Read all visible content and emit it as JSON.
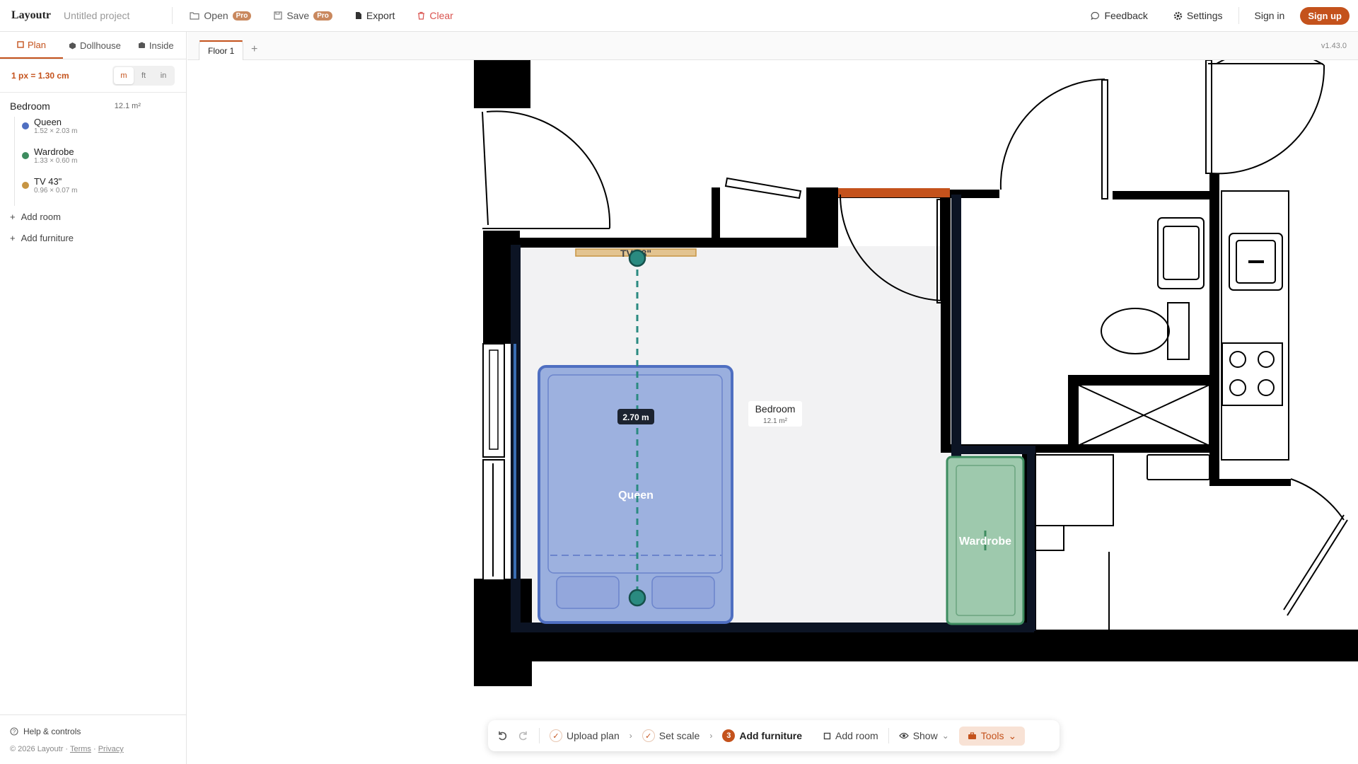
{
  "topbar": {
    "brand": "Layoutr",
    "project": "Untitled project",
    "open": "Open",
    "save": "Save",
    "pro_badge": "Pro",
    "export": "Export",
    "clear": "Clear",
    "feedback": "Feedback",
    "settings": "Settings",
    "sign_in": "Sign in",
    "sign_up": "Sign up"
  },
  "sidebar": {
    "tabs": [
      {
        "label": "Plan"
      },
      {
        "label": "Dollhouse"
      },
      {
        "label": "Inside"
      }
    ],
    "scale_label": "1 px = 1.30 cm",
    "units": [
      "m",
      "ft",
      "in"
    ],
    "room": {
      "name": "Bedroom",
      "area": "12.1 m²"
    },
    "items": [
      {
        "name": "Queen",
        "dims": "1.52 × 2.03 m",
        "color": "#4f6fc1"
      },
      {
        "name": "Wardrobe",
        "dims": "1.33 × 0.60 m",
        "color": "#3d8c5f"
      },
      {
        "name": "TV 43\"",
        "dims": "0.96 × 0.07 m",
        "color": "#c79542"
      }
    ],
    "add_room": "Add room",
    "add_furniture": "Add furniture",
    "help": "Help & controls",
    "copyright": "© 2026 Layoutr ·",
    "terms": "Terms",
    "privacy": "Privacy"
  },
  "floors": {
    "tab": "Floor 1",
    "version": "v1.43.0"
  },
  "canvas": {
    "tv_label": "TV 43\"",
    "measure": "2.70 m",
    "bed_label": "Queen",
    "wardrobe_label": "Wardrobe",
    "room_name": "Bedroom",
    "room_area": "12.1 m²"
  },
  "toolbar": {
    "upload": "Upload plan",
    "set_scale": "Set scale",
    "step_num": "3",
    "add_furniture": "Add furniture",
    "add_room": "Add room",
    "show": "Show",
    "tools": "Tools"
  }
}
